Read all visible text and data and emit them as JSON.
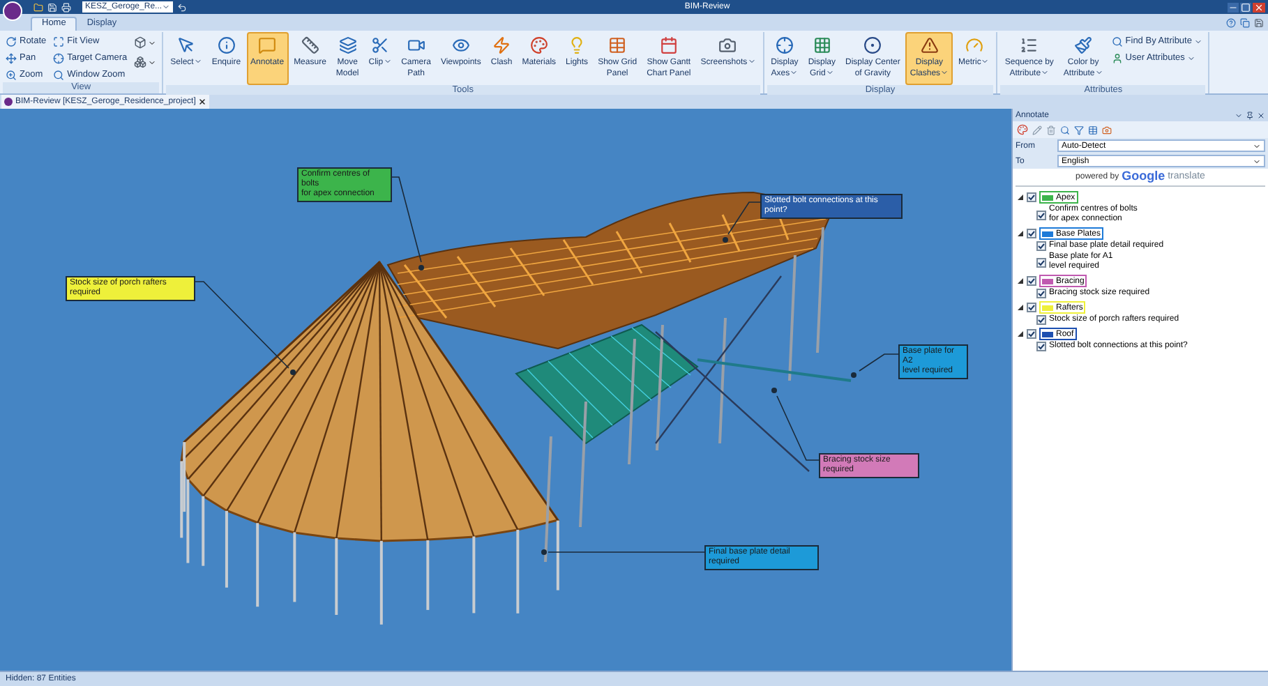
{
  "title_bar": {
    "document": "KESZ_Geroge_Re...",
    "title": "BIM-Review"
  },
  "ribbon_tabs": [
    {
      "label": "Home",
      "selected": true
    },
    {
      "label": "Display",
      "selected": false
    }
  ],
  "ribbon_groups": [
    {
      "label": "View",
      "buttons": [
        {
          "label": "Rotate",
          "kind": "small",
          "selected": false,
          "menu": false
        },
        {
          "label": "Pan",
          "kind": "small",
          "selected": false,
          "menu": false
        },
        {
          "label": "Zoom",
          "kind": "small",
          "selected": false,
          "menu": false
        },
        {
          "label": "Fit View",
          "kind": "small",
          "selected": false,
          "menu": false
        },
        {
          "label": "Target Camera",
          "kind": "small",
          "selected": false,
          "menu": false
        },
        {
          "label": "Window Zoom",
          "kind": "small",
          "selected": false,
          "menu": false
        },
        {
          "kind": "icon",
          "selected": false,
          "menu": true
        },
        {
          "kind": "icon",
          "selected": false,
          "menu": true
        }
      ]
    },
    {
      "label": "Tools",
      "buttons": [
        {
          "label": "Select",
          "kind": "large",
          "selected": false,
          "menu": true
        },
        {
          "label": "Enquire",
          "kind": "large",
          "selected": false,
          "menu": false
        },
        {
          "label": "Annotate",
          "kind": "large",
          "selected": true,
          "menu": false
        },
        {
          "label": "Measure",
          "kind": "large",
          "selected": false,
          "menu": false
        },
        {
          "label": "Move\nModel",
          "kind": "large",
          "selected": false,
          "menu": false
        },
        {
          "label": "Clip",
          "kind": "large",
          "selected": false,
          "menu": true
        },
        {
          "label": "Camera\nPath",
          "kind": "large",
          "selected": false,
          "menu": false
        },
        {
          "label": "Viewpoints",
          "kind": "large",
          "selected": false,
          "menu": false
        },
        {
          "label": "Clash",
          "kind": "large",
          "selected": false,
          "menu": false
        },
        {
          "label": "Materials",
          "kind": "large",
          "selected": false,
          "menu": false
        },
        {
          "label": "Lights",
          "kind": "large",
          "selected": false,
          "menu": false
        },
        {
          "label": "Show Grid\nPanel",
          "kind": "large",
          "selected": false,
          "menu": false
        },
        {
          "label": "Show Gantt\nChart Panel",
          "kind": "large",
          "selected": false,
          "menu": false
        },
        {
          "label": "Screenshots",
          "kind": "large",
          "selected": false,
          "menu": true
        }
      ]
    },
    {
      "label": "Display",
      "buttons": [
        {
          "label": "Display\nAxes",
          "kind": "large",
          "selected": false,
          "menu": true
        },
        {
          "label": "Display\nGrid",
          "kind": "large",
          "selected": false,
          "menu": true
        },
        {
          "label": "Display Center\nof Gravity",
          "kind": "large",
          "selected": false,
          "menu": false
        },
        {
          "label": "Display\nClashes",
          "kind": "large",
          "selected": true,
          "menu": true
        },
        {
          "label": "Metric",
          "kind": "large",
          "selected": false,
          "menu": true
        }
      ]
    },
    {
      "label": "Attributes",
      "buttons": [
        {
          "label": "Sequence by\nAttribute",
          "kind": "large",
          "selected": false,
          "menu": true
        },
        {
          "label": "Color by\nAttribute",
          "kind": "large",
          "selected": false,
          "menu": true
        },
        {
          "label": "Find By Attribute",
          "kind": "small",
          "selected": false,
          "menu": true
        },
        {
          "label": "User Attributes",
          "kind": "small",
          "selected": false,
          "menu": true
        }
      ]
    }
  ],
  "document_tab": {
    "label": "BIM-Review [KESZ_Geroge_Residence_project]"
  },
  "annotations": [
    {
      "text": "Confirm centres of bolts\nfor apex connection",
      "color": "#3cb44b"
    },
    {
      "text": "Slotted bolt connections at this point?",
      "color": "#2b5ea8"
    },
    {
      "text": "Stock size of porch rafters required",
      "color": "#eef03a"
    },
    {
      "text": "Base plate for A2\nlevel required",
      "color": "#1d9ad8"
    },
    {
      "text": "Bracing stock size required",
      "color": "#d27ab8"
    },
    {
      "text": "Final base plate detail required",
      "color": "#1d9ad8"
    }
  ],
  "annotate_panel": {
    "title": "Annotate",
    "from_label": "From",
    "from_value": "Auto-Detect",
    "to_label": "To",
    "to_value": "English",
    "powered_by": "powered by",
    "google": "Google",
    "translate": "translate",
    "tree": [
      {
        "label": "Apex",
        "color": "#3cb44b",
        "checked": true,
        "expanded": true,
        "children": [
          {
            "label": "Confirm centres of bolts\nfor apex connection",
            "checked": true
          }
        ]
      },
      {
        "label": "Base Plates",
        "color": "#1d7ad8",
        "checked": true,
        "expanded": true,
        "children": [
          {
            "label": "Final base plate detail required",
            "checked": true
          },
          {
            "label": "Base plate for A1\nlevel required",
            "checked": true
          }
        ]
      },
      {
        "label": "Bracing",
        "color": "#c05ab0",
        "checked": true,
        "expanded": true,
        "children": [
          {
            "label": "Bracing stock size required",
            "checked": true
          }
        ]
      },
      {
        "label": "Rafters",
        "color": "#eef03a",
        "checked": true,
        "expanded": true,
        "children": [
          {
            "label": "Stock size of porch rafters required",
            "checked": true
          }
        ]
      },
      {
        "label": "Roof",
        "color": "#1d4fb0",
        "checked": true,
        "expanded": true,
        "children": [
          {
            "label": "Slotted bolt connections at this point?",
            "checked": true
          }
        ]
      }
    ]
  },
  "status_bar": {
    "text": "Hidden: 87 Entities"
  }
}
